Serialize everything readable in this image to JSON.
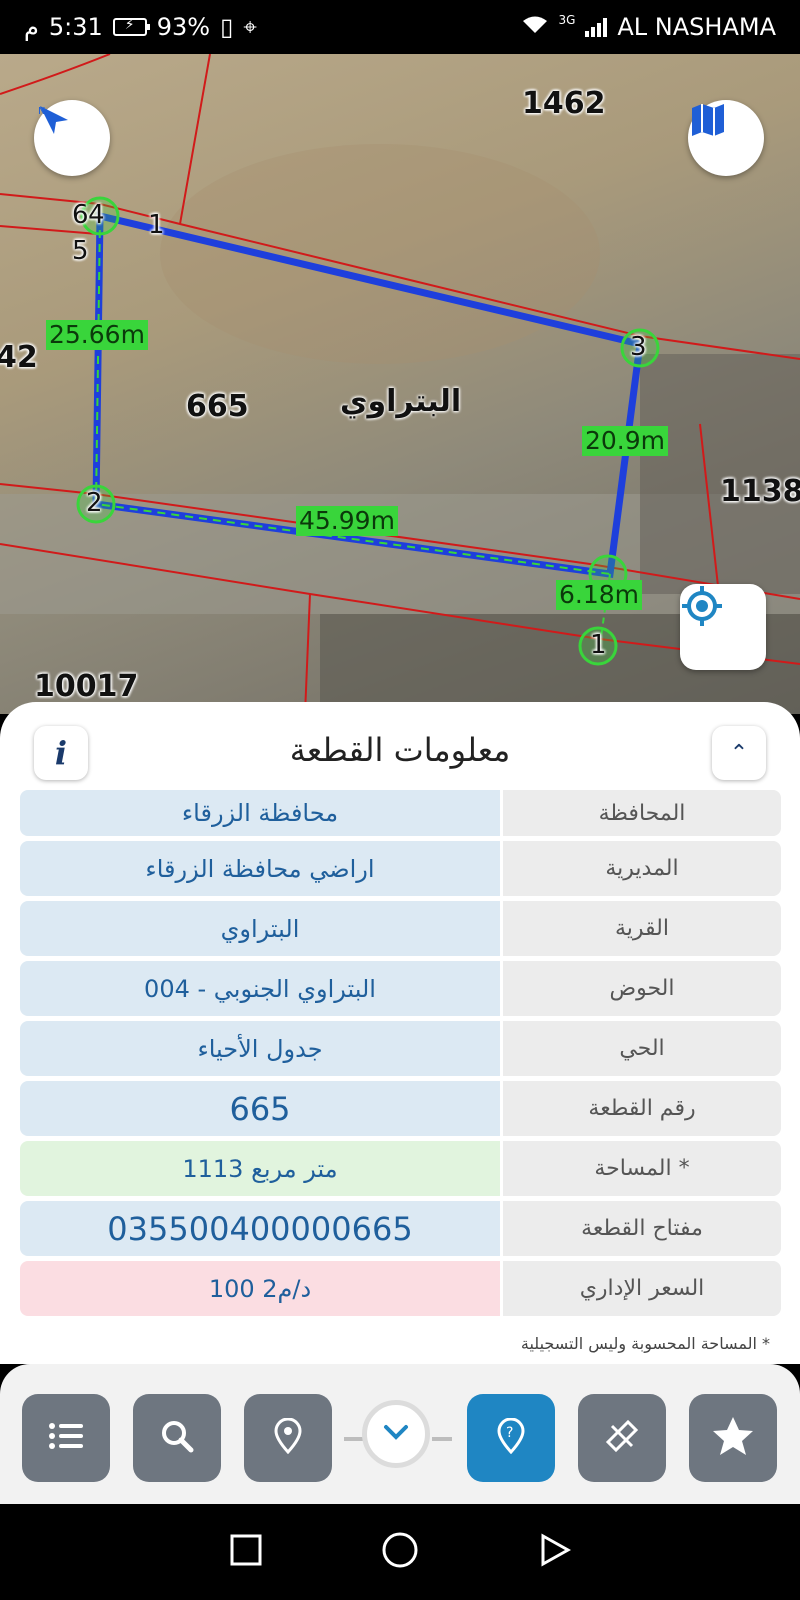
{
  "status_bar": {
    "time": "5:31",
    "period": "م",
    "battery": "93%",
    "network_type": "3G",
    "carrier": "AL NASHAMA"
  },
  "map": {
    "parcel_labels": [
      "1462",
      "665",
      "10017",
      "1138",
      "42"
    ],
    "village_label": "البتراوي",
    "measurements": [
      "25.66m",
      "45.99m",
      "20.9m",
      "6.18m"
    ],
    "vertex_labels": [
      "1",
      "2",
      "3",
      "4",
      "5",
      "6",
      "1",
      "2",
      "3",
      "4"
    ],
    "icons": {
      "compass": "compass-arrow-icon",
      "layers": "map-layers-icon",
      "locate": "my-location-icon"
    }
  },
  "panel": {
    "title": "معلومات القطعة",
    "info_icon": "i",
    "rows": [
      {
        "label": "المحافظة",
        "value": "محافظة الزرقاء"
      },
      {
        "label": "المديرية",
        "value": "اراضي محافظة الزرقاء"
      },
      {
        "label": "القرية",
        "value": "البتراوي"
      },
      {
        "label": "الحوض",
        "value": "البتراوي الجنوبي - 004"
      },
      {
        "label": "الحي",
        "value": "جدول الأحياء"
      },
      {
        "label": "رقم القطعة",
        "value": "665"
      },
      {
        "label": "المساحة *",
        "value": "1113  متر مربع"
      },
      {
        "label": "مفتاح القطعة",
        "value": "035500400000665"
      },
      {
        "label": "السعر الإداري",
        "value": "100 د/م2"
      }
    ],
    "footnote": "* المساحة المحسوبة وليس التسجيلية"
  },
  "toolbar": {
    "tools": [
      "list-icon",
      "search-icon",
      "location-pin-icon",
      "chevron-down-icon",
      "help-pin-icon",
      "measure-tool-icon",
      "star-icon"
    ]
  },
  "colors": {
    "accent": "#1f86c3",
    "parcel_outline": "#1e3fdc",
    "measure_green": "#39d53b",
    "boundary_red": "#d11a1a"
  }
}
